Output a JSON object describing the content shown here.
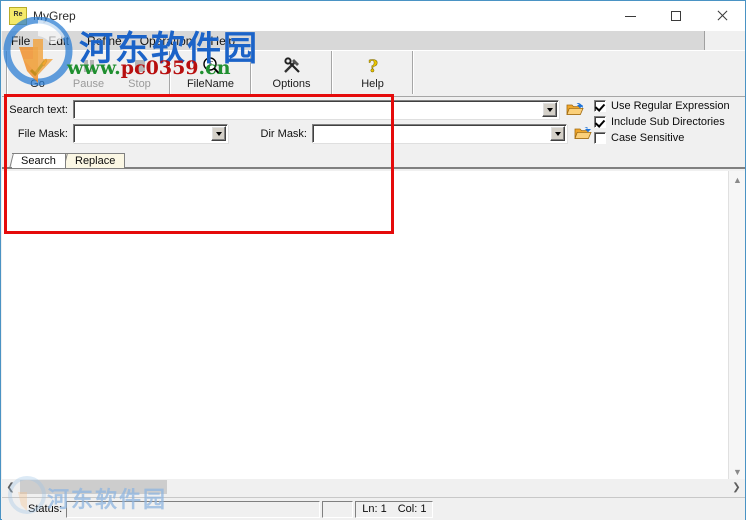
{
  "window": {
    "title": "MyGrep",
    "icon_name": "app-icon-re",
    "icon_text": "Re",
    "controls": {
      "minimize": "minimize-icon",
      "maximize": "maximize-icon",
      "close": "close-icon"
    }
  },
  "menubar": {
    "items": [
      {
        "label": "File"
      },
      {
        "label": "Edit"
      },
      {
        "label": "Refine"
      },
      {
        "label": "Operation"
      },
      {
        "label": "Help"
      }
    ]
  },
  "toolbar": {
    "buttons": [
      {
        "label": "Go",
        "icon": "check-pencil-icon",
        "enabled": true
      },
      {
        "label": "Pause",
        "icon": "pause-icon",
        "enabled": false
      },
      {
        "label": "Stop",
        "icon": "stop-square-icon",
        "enabled": false
      },
      {
        "label": "FileName",
        "icon": "magnifier-f-icon",
        "enabled": true
      },
      {
        "label": "Options",
        "icon": "hammer-wrench-icon",
        "enabled": true
      },
      {
        "label": "Help",
        "icon": "question-mark-icon",
        "enabled": true
      }
    ]
  },
  "search_panel": {
    "search_text": {
      "label": "Search text:",
      "value": "",
      "placeholder": ""
    },
    "file_mask": {
      "label": "File Mask:",
      "value": "",
      "placeholder": ""
    },
    "dir_mask": {
      "label": "Dir Mask:",
      "value": "",
      "placeholder": ""
    },
    "browse_buttons": [
      {
        "name": "browse-search-text-folder",
        "icon": "open-folder-icon"
      },
      {
        "name": "browse-dir-mask-folder",
        "icon": "open-folder-icon"
      }
    ],
    "options": [
      {
        "label": "Use Regular Expression",
        "checked": true
      },
      {
        "label": "Include Sub Directories",
        "checked": true
      },
      {
        "label": "Case Sensitive",
        "checked": false
      }
    ]
  },
  "tabs": [
    {
      "label": "Search",
      "active": true
    },
    {
      "label": "Replace",
      "active": false
    }
  ],
  "results": {
    "content": ""
  },
  "statusbar": {
    "status_label": "Status:",
    "status_value": "",
    "line_label": "Ln: 1",
    "col_label": "Col: 1"
  },
  "scrollbars": {
    "vertical": {
      "up": "scroll-up-icon",
      "down": "scroll-down-icon"
    },
    "horizontal": {
      "left": "scroll-left-icon",
      "right": "scroll-right-icon"
    }
  },
  "annotation": {
    "color": "#e50b0b",
    "name": "highlight-box-search-panel"
  },
  "watermark": {
    "site_cn": "河东软件园",
    "url_www": "www.",
    "url_domain": "pc0359",
    "url_tld": ".cn",
    "url_full": "www.pc0359.cn",
    "bottom_cn": "河东软件园"
  }
}
